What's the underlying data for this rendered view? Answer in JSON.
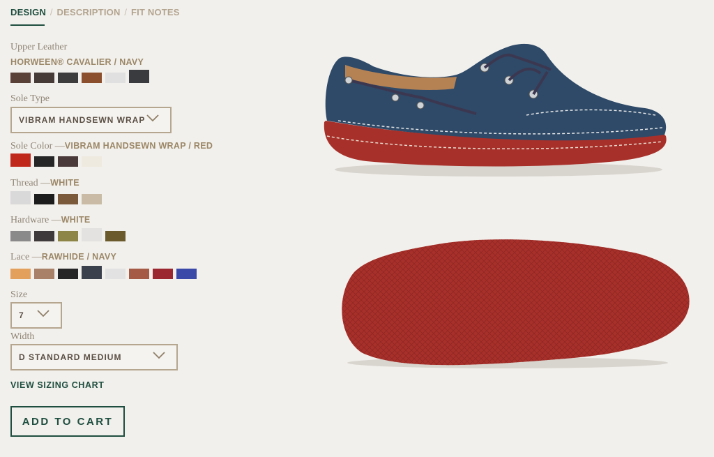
{
  "tabs": [
    {
      "label": "DESIGN",
      "active": true
    },
    {
      "label": "DESCRIPTION",
      "active": false
    },
    {
      "label": "FIT NOTES",
      "active": false
    }
  ],
  "upper_leather": {
    "label": "Upper Leather",
    "value": "HORWEEN® CAVALIER / NAVY",
    "swatches": [
      "#5a4137",
      "#463b37",
      "#3e3d3d",
      "#8c4f2d",
      "#e0e0e0",
      "#3a3b3e"
    ],
    "selected_index": 5
  },
  "sole_type": {
    "label": "Sole Type",
    "value": "VIBRAM HANDSEWN WRAP"
  },
  "sole_color": {
    "label": "Sole Color —",
    "value": "VIBRAM HANDSEWN WRAP / RED",
    "swatches": [
      "#c0281c",
      "#262626",
      "#4a3b3a",
      "#eeeadf"
    ],
    "selected_index": 0
  },
  "thread": {
    "label": "Thread —",
    "value": "WHITE",
    "swatches": [
      "#d9d9d9",
      "#1c1c1c",
      "#7a5a3b",
      "#c9bba5"
    ],
    "selected_index": 0
  },
  "hardware": {
    "label": "Hardware —",
    "value": "WHITE",
    "swatches": [
      "#8a8a8a",
      "#3e3a3b",
      "#8d8547",
      "#e3e2e0",
      "#6b5a2c"
    ],
    "selected_index": 3
  },
  "lace": {
    "label": "Lace —",
    "value": "RAWHIDE / NAVY",
    "swatches": [
      "#e3a05c",
      "#a98068",
      "#262626",
      "#3a414d",
      "#e2e2e2",
      "#a45a45",
      "#9b2730",
      "#3a48a8"
    ],
    "selected_index": 3
  },
  "size": {
    "label": "Size",
    "value": "7"
  },
  "width": {
    "label": "Width",
    "value": "D STANDARD MEDIUM"
  },
  "links": {
    "sizing_chart": "VIEW SIZING CHART"
  },
  "cart": {
    "label": "ADD TO CART"
  },
  "colors": {
    "accent": "#1e4e3f",
    "border": "#b5a68f",
    "shoe_navy": "#2e4a68",
    "sole_red": "#a8302a"
  }
}
